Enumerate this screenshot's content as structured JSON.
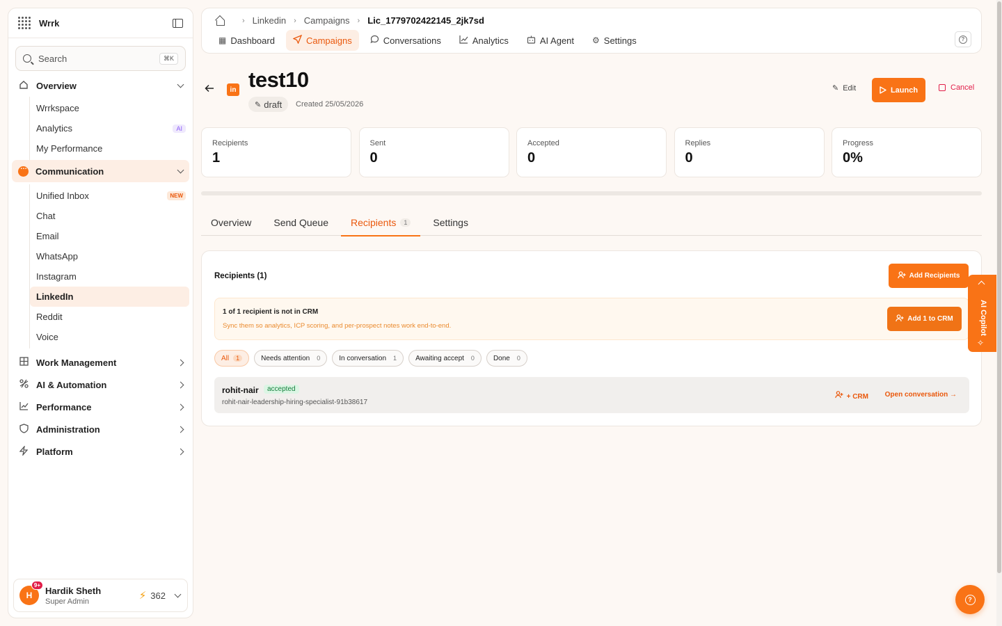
{
  "app": {
    "brand": "Wrrk",
    "search_placeholder": "Search",
    "search_kbd": "⌘K"
  },
  "sidebar": {
    "overview": {
      "label": "Overview",
      "items": [
        {
          "label": "Wrrkspace"
        },
        {
          "label": "Analytics",
          "badge": "AI"
        },
        {
          "label": "My Performance"
        }
      ]
    },
    "communication": {
      "label": "Communication",
      "items": [
        {
          "label": "Unified Inbox",
          "badge": "NEW"
        },
        {
          "label": "Chat"
        },
        {
          "label": "Email"
        },
        {
          "label": "WhatsApp"
        },
        {
          "label": "Instagram"
        },
        {
          "label": "LinkedIn"
        },
        {
          "label": "Reddit"
        },
        {
          "label": "Voice"
        }
      ]
    },
    "groups": [
      {
        "label": "Work Management"
      },
      {
        "label": "AI & Automation"
      },
      {
        "label": "Performance"
      },
      {
        "label": "Administration"
      },
      {
        "label": "Platform"
      }
    ],
    "user": {
      "initial": "H",
      "notif": "9+",
      "name": "Hardik Sheth",
      "role": "Super Admin",
      "credits": "362"
    }
  },
  "header": {
    "breadcrumbs": [
      "Linkedin",
      "Campaigns",
      "Lic_1779702422145_2jk7sd"
    ],
    "tabs": [
      {
        "label": "Dashboard",
        "icon": "dashboard-icon"
      },
      {
        "label": "Campaigns",
        "icon": "send-icon"
      },
      {
        "label": "Conversations",
        "icon": "chat-icon"
      },
      {
        "label": "Analytics",
        "icon": "chart-icon"
      },
      {
        "label": "AI Agent",
        "icon": "bot-icon"
      },
      {
        "label": "Settings",
        "icon": "gear-icon"
      }
    ]
  },
  "campaign": {
    "channel_icon": "in",
    "title": "test10",
    "status": "draft",
    "created": "Created 25/05/2026",
    "actions": {
      "edit": "Edit",
      "launch": "Launch",
      "cancel": "Cancel"
    },
    "stats": [
      {
        "label": "Recipients",
        "value": "1"
      },
      {
        "label": "Sent",
        "value": "0"
      },
      {
        "label": "Accepted",
        "value": "0"
      },
      {
        "label": "Replies",
        "value": "0"
      },
      {
        "label": "Progress",
        "value": "0%"
      }
    ],
    "progress_fraction": 0
  },
  "content_tabs": [
    {
      "label": "Overview"
    },
    {
      "label": "Send Queue"
    },
    {
      "label": "Recipients",
      "count": "1"
    },
    {
      "label": "Settings"
    }
  ],
  "recipients": {
    "title": "Recipients (1)",
    "add_button": "Add Recipients",
    "crm_notice": {
      "title": "1 of 1 recipient is not in CRM",
      "subtitle": "Sync them so analytics, ICP scoring, and per-prospect notes work end-to-end.",
      "button": "Add 1 to CRM"
    },
    "filters": [
      {
        "label": "All",
        "count": "1"
      },
      {
        "label": "Needs attention",
        "count": "0"
      },
      {
        "label": "In conversation",
        "count": "1"
      },
      {
        "label": "Awaiting accept",
        "count": "0"
      },
      {
        "label": "Done",
        "count": "0"
      }
    ],
    "rows": [
      {
        "name": "rohit-nair",
        "status": "accepted",
        "slug": "rohit-nair-leadership-hiring-specialist-91b38617",
        "crm_action": "+ CRM",
        "open_action": "Open conversation"
      }
    ]
  },
  "copilot": {
    "label": "AI Copilot"
  },
  "colors": {
    "accent": "#f97316",
    "accepted": "#15803d",
    "cancel": "#e11d48"
  }
}
